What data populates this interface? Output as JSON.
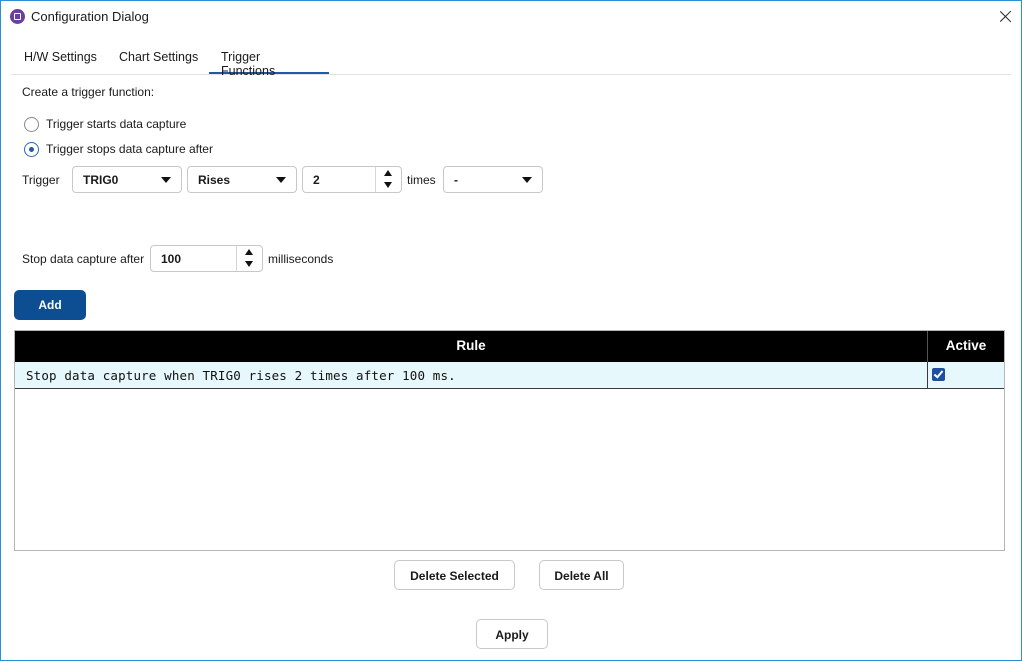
{
  "window": {
    "title": "Configuration Dialog",
    "icon": "app-icon",
    "accent_color": "#2b8fd6"
  },
  "tabs": [
    {
      "label": "H/W Settings",
      "active": false
    },
    {
      "label": "Chart Settings",
      "active": false
    },
    {
      "label": "Trigger Functions",
      "active": true
    }
  ],
  "trigger": {
    "create_label": "Create a trigger function:",
    "options": [
      {
        "label": "Trigger starts data capture",
        "selected": false
      },
      {
        "label": "Trigger stops data capture after",
        "selected": true
      }
    ],
    "trigger_label": "Trigger",
    "source_value": "TRIG0",
    "edge_value": "Rises",
    "count_value": "2",
    "times_label": "times",
    "mode_value": "-",
    "stop_label": "Stop data capture after",
    "stop_value": "100",
    "stop_unit": "milliseconds",
    "add_label": "Add"
  },
  "table": {
    "columns": [
      "Rule",
      "Active"
    ],
    "rows": [
      {
        "rule": "Stop data capture when TRIG0 rises 2 times after 100 ms.",
        "active": true
      }
    ]
  },
  "actions": {
    "delete_selected": "Delete Selected",
    "delete_all": "Delete All",
    "apply": "Apply"
  },
  "colors": {
    "primary_button": "#0d4d92",
    "table_header": "#000000",
    "row_highlight": "#e6f8fb",
    "tab_underline": "#1e5aa8"
  }
}
